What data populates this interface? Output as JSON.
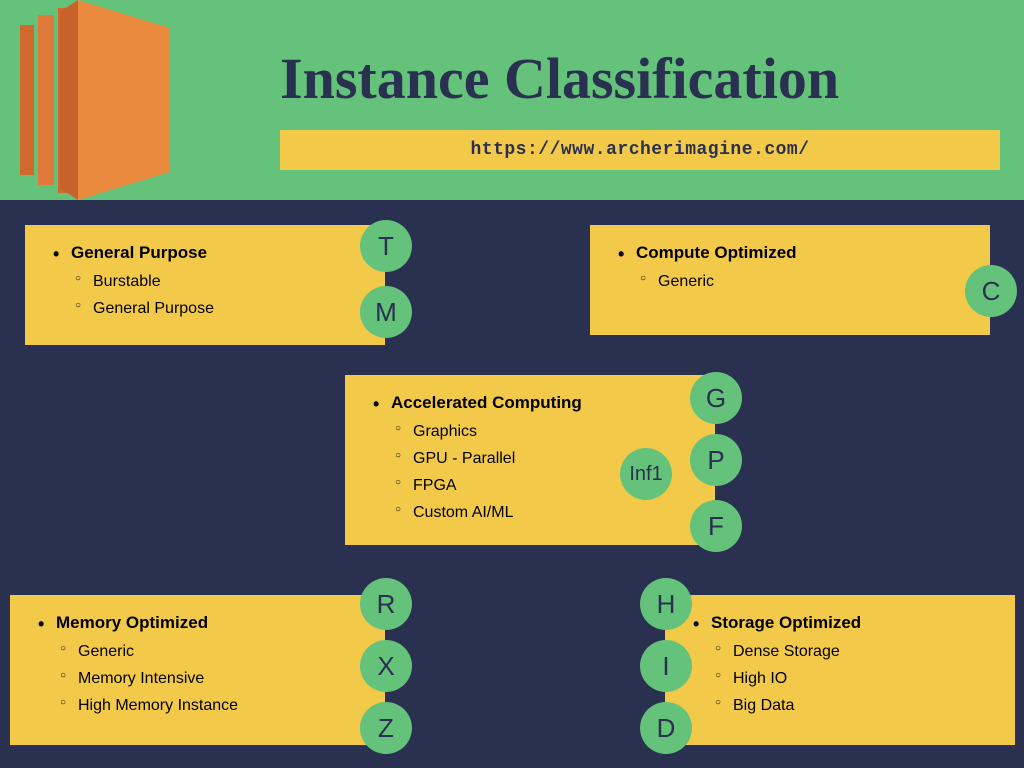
{
  "header": {
    "title": "Instance Classification",
    "url": "https://www.archerimagine.com/"
  },
  "cards": {
    "general": {
      "title": "General Purpose",
      "items": [
        "Burstable",
        "General Purpose"
      ],
      "bubbles": [
        "T",
        "M"
      ]
    },
    "compute": {
      "title": "Compute Optimized",
      "items": [
        "Generic"
      ],
      "bubbles": [
        "C"
      ]
    },
    "accel": {
      "title": "Accelerated Computing",
      "items": [
        "Graphics",
        "GPU - Parallel",
        "FPGA",
        "Custom AI/ML"
      ],
      "bubbles": [
        "G",
        "P",
        "F"
      ],
      "extra_bubble": "Inf1"
    },
    "memory": {
      "title": "Memory Optimized",
      "items": [
        "Generic",
        "Memory Intensive",
        "High Memory Instance"
      ],
      "bubbles": [
        "R",
        "X",
        "Z"
      ]
    },
    "storage": {
      "title": "Storage Optimized",
      "items": [
        "Dense Storage",
        "High IO",
        "Big Data"
      ],
      "bubbles": [
        "H",
        "I",
        "D"
      ]
    }
  }
}
